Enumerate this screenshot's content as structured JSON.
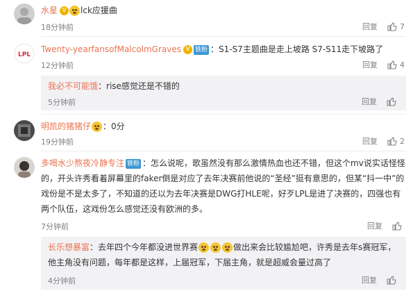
{
  "labels": {
    "reply": "回复"
  },
  "comments": [
    {
      "username": "水星",
      "text": "lck应援曲",
      "time": "18分钟前",
      "likes": "7"
    },
    {
      "username": "Twenty-yearfansofMalcolmGraves",
      "badge": "铁粉",
      "text": "：S1-S7主题曲是走上坡路 S7-S11走下坡路了",
      "time": "12分钟前",
      "likes": "4",
      "reply": {
        "username": "我必不可能饿",
        "text": "：rise感觉还是不错的",
        "time": "5分钟前"
      }
    },
    {
      "username": "明凯的猪猪仔",
      "text": "：0分",
      "time": "19分钟前",
      "likes": "2"
    },
    {
      "username": "多喝水少熬夜冷静专注",
      "badge": "铁粉",
      "text": "：怎么说呢，歌虽然没有那么激情热血也还不错，但这个mv说实话怪怪的，开头许秀看着屏幕里的faker倒是对应了去年决赛前他说的“圣经”挺有意思的，但某“抖一中”的戏份是不是太多了，不知道的还以为去年决赛是DWG打HLE呢，好歹LPL是进了决赛的，四强也有两个队伍，这戏份怎么感觉还没有欧洲的多。",
      "time": "7分钟前",
      "reply": {
        "username": "长乐想暴富",
        "text_a": "：去年四个今年都没进世界赛",
        "text_b": "做出来会比较尴尬吧，许秀是去年s赛冠军，他主角没有问题，每年都是这样，上届冠军，下届主角，就是超威会量过高了",
        "time": "4分钟前"
      }
    }
  ]
}
